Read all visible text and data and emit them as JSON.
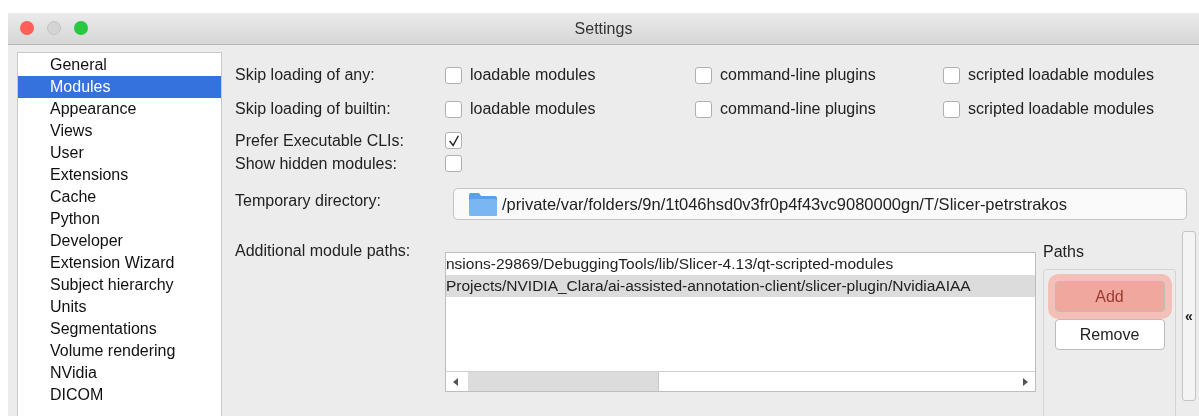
{
  "window": {
    "title": "Settings"
  },
  "sidebar": {
    "items": [
      {
        "label": "General",
        "selected": false
      },
      {
        "label": "Modules",
        "selected": true
      },
      {
        "label": "Appearance",
        "selected": false
      },
      {
        "label": "Views",
        "selected": false
      },
      {
        "label": "User",
        "selected": false
      },
      {
        "label": "Extensions",
        "selected": false
      },
      {
        "label": "Cache",
        "selected": false
      },
      {
        "label": "Python",
        "selected": false
      },
      {
        "label": "Developer",
        "selected": false
      },
      {
        "label": "Extension Wizard",
        "selected": false
      },
      {
        "label": "Subject hierarchy",
        "selected": false
      },
      {
        "label": "Units",
        "selected": false
      },
      {
        "label": "Segmentations",
        "selected": false
      },
      {
        "label": "Volume rendering",
        "selected": false
      },
      {
        "label": "NVidia",
        "selected": false
      },
      {
        "label": "DICOM",
        "selected": false
      }
    ]
  },
  "skip_rows": [
    {
      "label": "Skip loading of any:",
      "options": [
        {
          "label": "loadable modules",
          "checked": false
        },
        {
          "label": "command-line plugins",
          "checked": false
        },
        {
          "label": "scripted loadable modules",
          "checked": false
        }
      ]
    },
    {
      "label": "Skip loading of builtin:",
      "options": [
        {
          "label": "loadable modules",
          "checked": false
        },
        {
          "label": "command-line plugins",
          "checked": false
        },
        {
          "label": "scripted loadable modules",
          "checked": false
        }
      ]
    }
  ],
  "single_checks": [
    {
      "label": "Prefer Executable CLIs:",
      "checked": true
    },
    {
      "label": "Show hidden modules:",
      "checked": false
    }
  ],
  "temporary_directory": {
    "label": "Temporary directory:",
    "value": "/private/var/folders/9n/1t046hsd0v3fr0p4f43vc9080000gn/T/Slicer-petrstrakos"
  },
  "additional_module_paths": {
    "label": "Additional module paths:",
    "rows": [
      {
        "text": "nsions-29869/DebuggingTools/lib/Slicer-4.13/qt-scripted-modules",
        "selected": false
      },
      {
        "text": "Projects/NVIDIA_Clara/ai-assisted-annotation-client/slicer-plugin/NvidiaAIAA",
        "selected": true
      }
    ]
  },
  "paths_group": {
    "title": "Paths",
    "buttons": [
      {
        "label": "Add",
        "highlighted": true
      },
      {
        "label": "Remove",
        "highlighted": false
      }
    ]
  },
  "collapse_button": {
    "label": "«"
  }
}
